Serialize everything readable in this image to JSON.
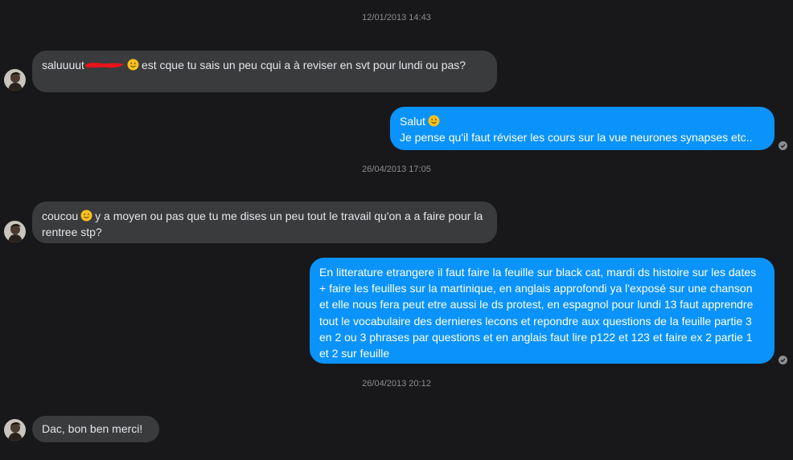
{
  "conversation": {
    "timestamps": [
      "12/01/2013 14:43",
      "26/04/2013 17:05",
      "26/04/2013 20:12"
    ],
    "messages": [
      {
        "direction": "incoming",
        "before_redaction": "saluuuut",
        "after_emoji": "est cque tu sais un peu cqui a à reviser en svt pour lundi ou pas?"
      },
      {
        "direction": "outgoing",
        "line1": "Salut",
        "line2": "Je pense qu'il faut réviser les cours sur la vue neurones synapses etc.."
      },
      {
        "direction": "incoming",
        "before_emoji": "coucou",
        "after_emoji": "y a moyen ou pas que tu me dises un peu tout le travail qu'on a a faire pour la rentree stp?"
      },
      {
        "direction": "outgoing",
        "text": "En litterature etrangere il faut faire la feuille sur black cat, mardi ds histoire sur les dates + faire les feuilles sur la martinique, en anglais approfondi ya l'exposé sur une chanson et elle nous fera peut etre aussi le ds protest, en espagnol pour lundi 13 faut apprendre tout le vocabulaire des dernieres lecons et repondre aux questions de la feuille partie 3 en 2 ou 3 phrases par questions et en anglais faut lire p122 et 123 et faire ex 2 partie 1 et 2 sur feuille"
      },
      {
        "direction": "incoming",
        "text": "Dac, bon ben merci!"
      }
    ]
  },
  "colors": {
    "background": "#18181a",
    "incoming_bubble": "#3a3b3c",
    "outgoing_bubble": "#0a93fa",
    "timestamp_text": "#8a8d91",
    "redaction": "#e8141c"
  },
  "icons": {
    "avatar": "contact-avatar",
    "emoji": "slightly-smiling-face-icon",
    "seen": "seen-check-icon"
  }
}
